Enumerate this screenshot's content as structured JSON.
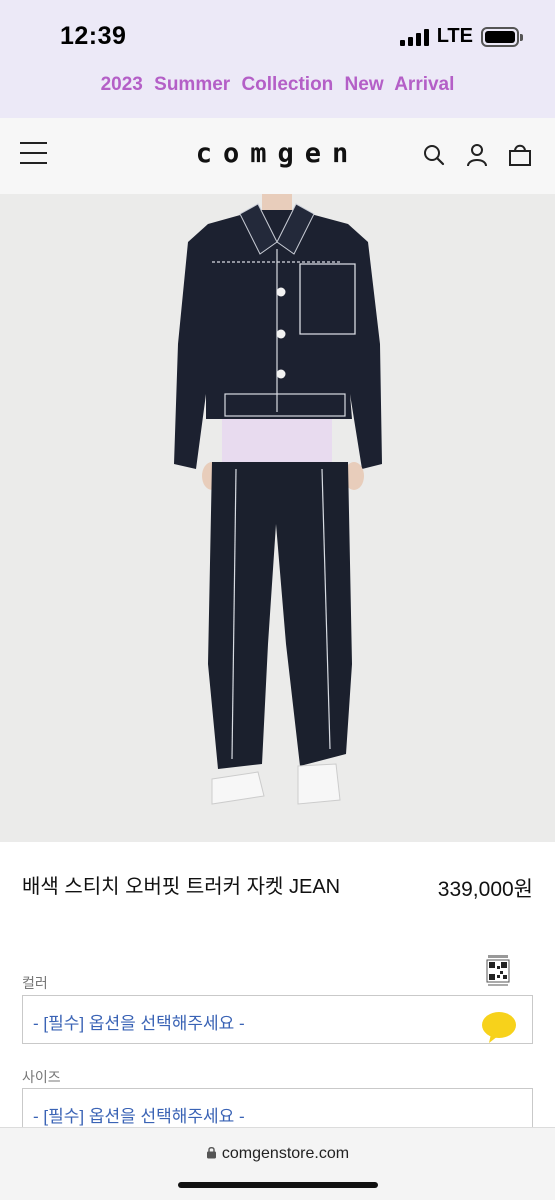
{
  "status_bar": {
    "time": "12:39",
    "network": "LTE",
    "icons": [
      "signal-icon",
      "battery-icon"
    ]
  },
  "banner": {
    "text": "2023  Summer  Collection  New  Arrival",
    "color": "#b45fc7",
    "background": "#ece9f7"
  },
  "header": {
    "logo": "comgen",
    "icons": [
      "menu-icon",
      "search-icon",
      "user-icon",
      "shopping-bag-icon"
    ]
  },
  "product": {
    "name": "배색 스티치 오버핏 트러커 자켓 JEAN",
    "price": "339,000원"
  },
  "options": [
    {
      "label": "컬러",
      "placeholder": "- [필수] 옵션을 선택해주세요 -"
    },
    {
      "label": "사이즈",
      "placeholder": "- [필수] 옵션을 선택해주세요 -"
    }
  ],
  "browser": {
    "url": "comgenstore.com",
    "icons": [
      "lock-icon"
    ]
  },
  "colors": {
    "accent_link": "#3a63b5",
    "kakao_yellow": "#f7d21b"
  }
}
